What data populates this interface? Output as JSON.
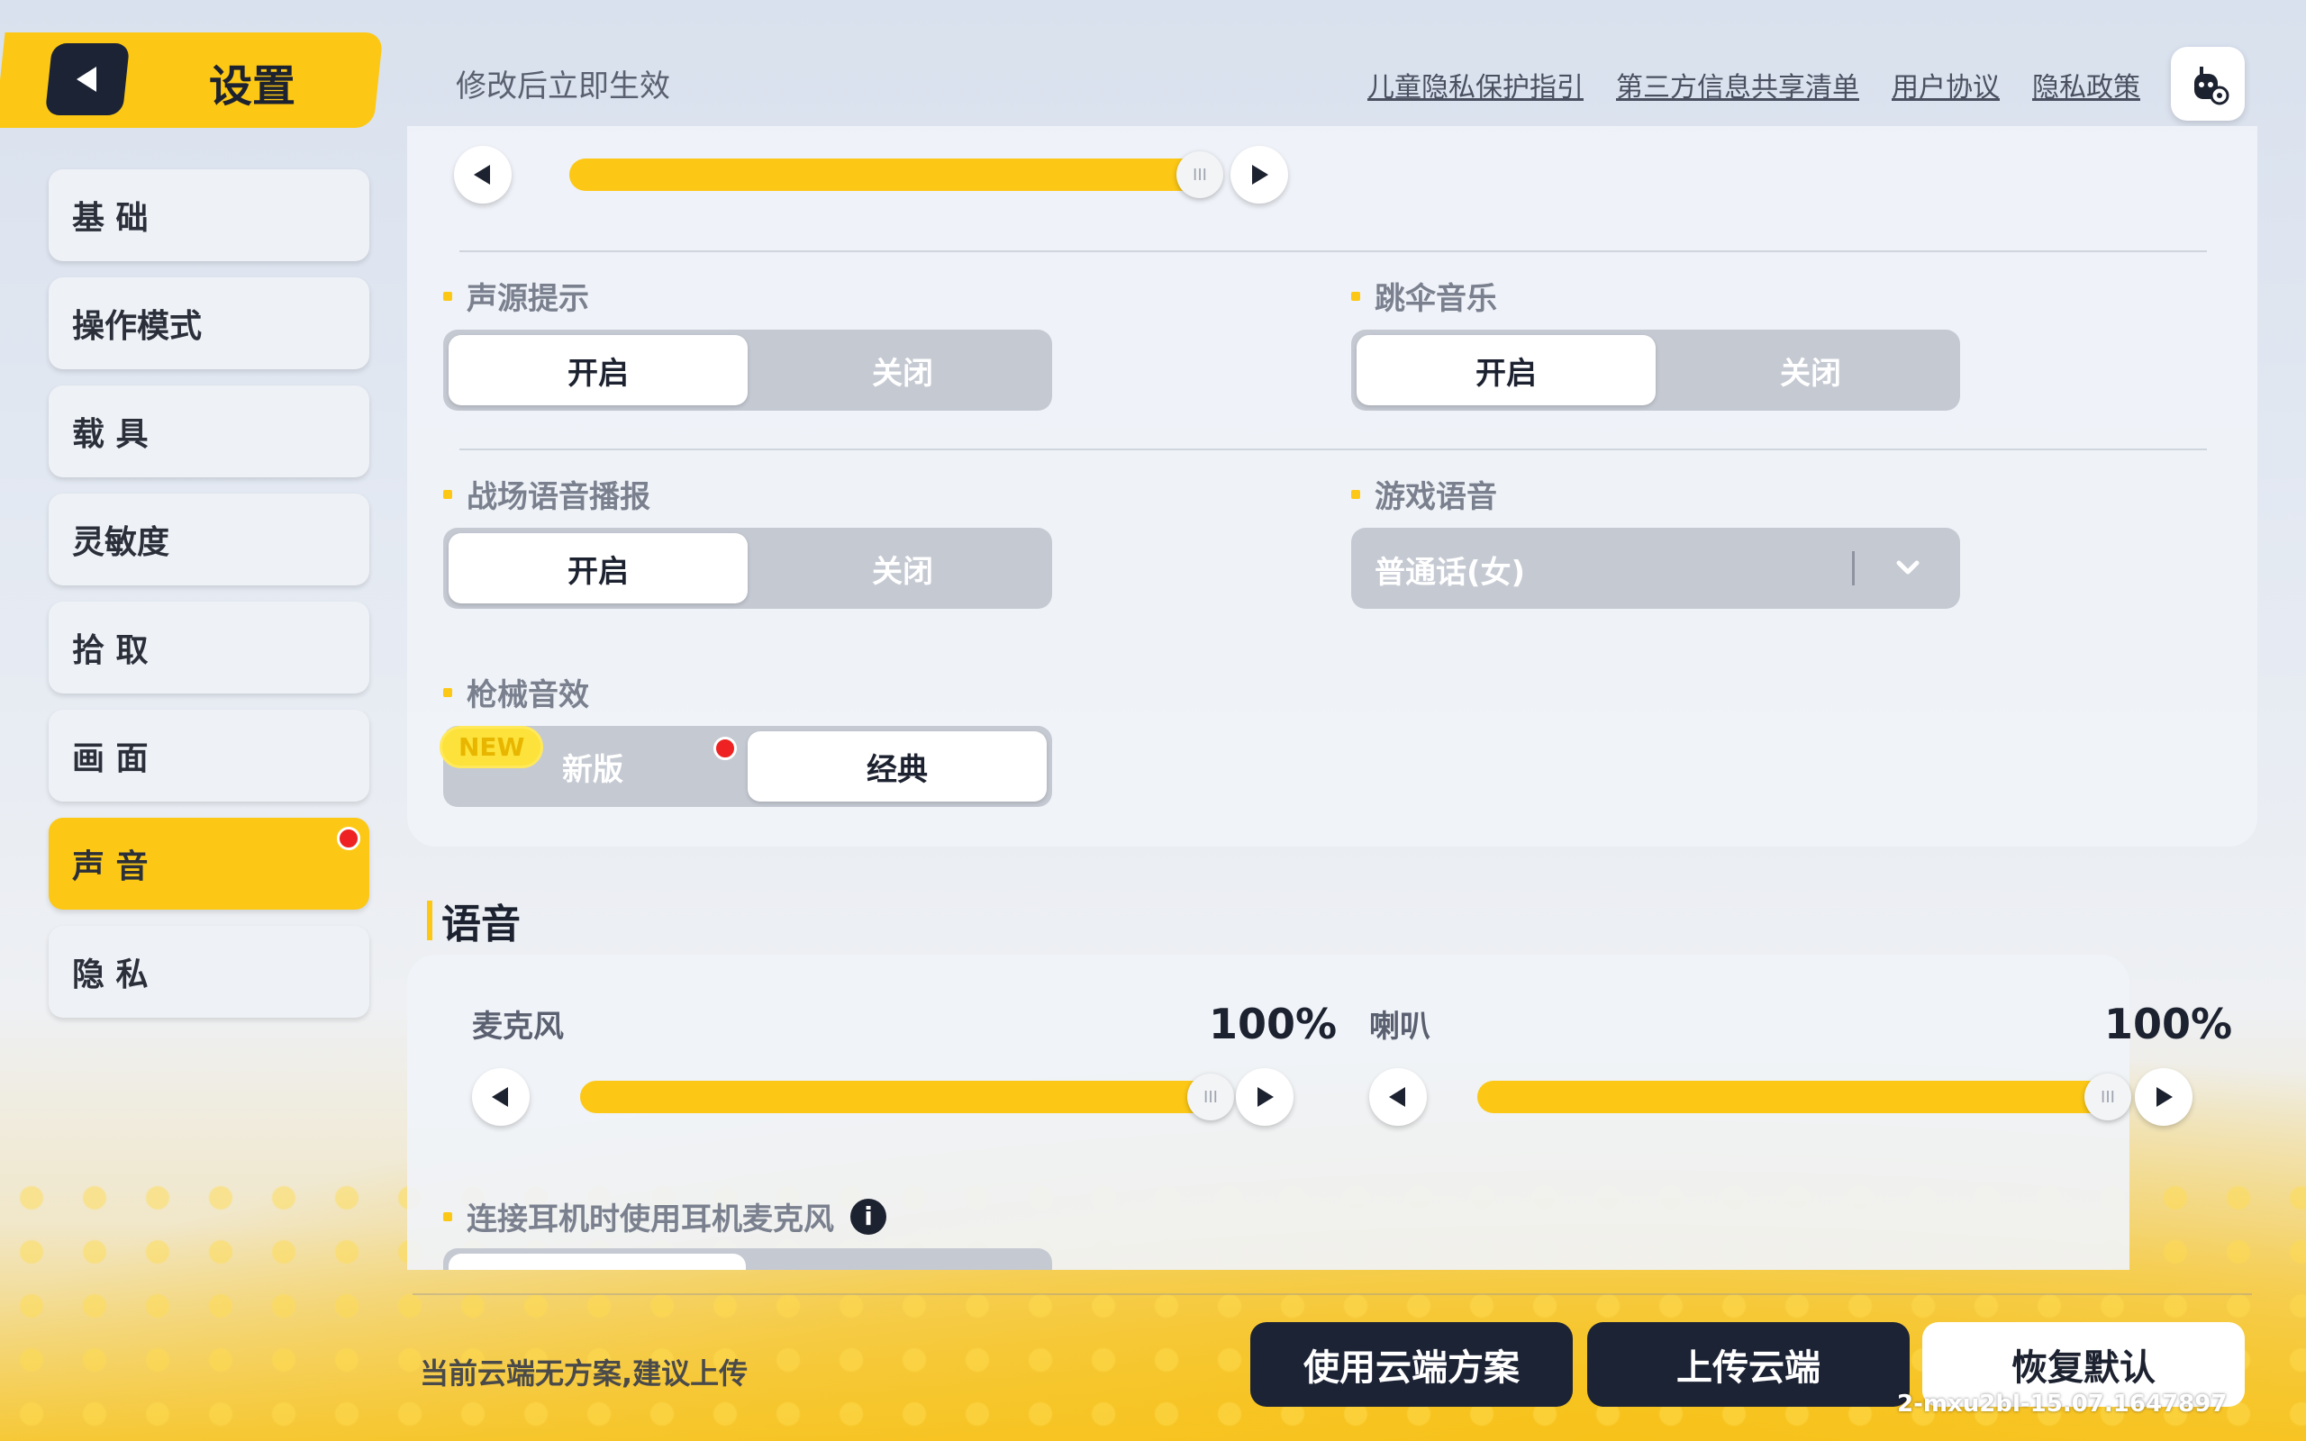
{
  "header": {
    "title": "设置",
    "hint": "修改后立即生效",
    "links": [
      "儿童隐私保护指引",
      "第三方信息共享清单",
      "用户协议",
      "隐私政策"
    ]
  },
  "sidebar": {
    "items": [
      {
        "label": "基 础"
      },
      {
        "label": "操作模式"
      },
      {
        "label": "载 具"
      },
      {
        "label": "灵敏度"
      },
      {
        "label": "拾 取"
      },
      {
        "label": "画 面"
      },
      {
        "label": "声 音",
        "active": true,
        "badge": true
      },
      {
        "label": "隐 私"
      }
    ]
  },
  "sound": {
    "top_slider_value": 100,
    "source_hint": {
      "label": "声源提示",
      "on": "开启",
      "off": "关闭",
      "selected": "开启"
    },
    "parachute_music": {
      "label": "跳伞音乐",
      "on": "开启",
      "off": "关闭",
      "selected": "开启"
    },
    "battle_voice": {
      "label": "战场语音播报",
      "on": "开启",
      "off": "关闭",
      "selected": "开启"
    },
    "game_voice": {
      "label": "游戏语音",
      "value": "普通话(女)"
    },
    "gun_sfx": {
      "label": "枪械音效",
      "new_badge": "NEW",
      "new": "新版",
      "classic": "经典",
      "selected": "经典"
    }
  },
  "voice": {
    "section_title": "语音",
    "mic": {
      "label": "麦克风",
      "percent": "100%",
      "value": 100
    },
    "speaker": {
      "label": "喇叭",
      "percent": "100%",
      "value": 100
    },
    "headset_mic": {
      "label": "连接耳机时使用耳机麦克风"
    }
  },
  "footer": {
    "hint": "当前云端无方案,建议上传",
    "use_cloud": "使用云端方案",
    "upload_cloud": "上传云端",
    "restore_default": "恢复默认",
    "build": "2-mxu2bl-15.07.1647897"
  },
  "colors": {
    "accent": "#fcc815",
    "dark": "#1c2335"
  }
}
